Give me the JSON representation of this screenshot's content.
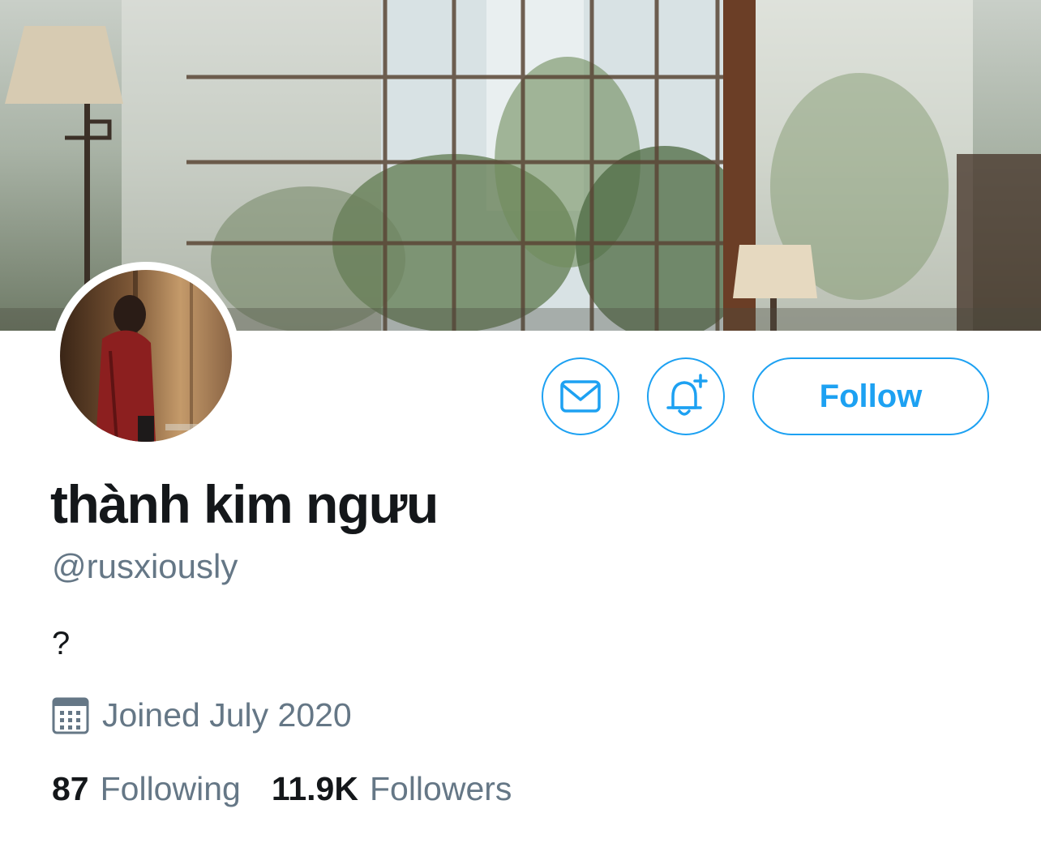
{
  "profile": {
    "display_name": "thành kim ngưu",
    "handle": "@rusxiously",
    "bio": "?",
    "joined": "Joined July 2020"
  },
  "actions": {
    "message_icon": "envelope-icon",
    "notify_icon": "bell-plus-icon",
    "follow_label": "Follow"
  },
  "stats": {
    "following_count": "87",
    "following_label": "Following",
    "followers_count": "11.9K",
    "followers_label": "Followers"
  },
  "colors": {
    "accent": "#1da1f2",
    "text_primary": "#14171a",
    "text_secondary": "#657786"
  }
}
